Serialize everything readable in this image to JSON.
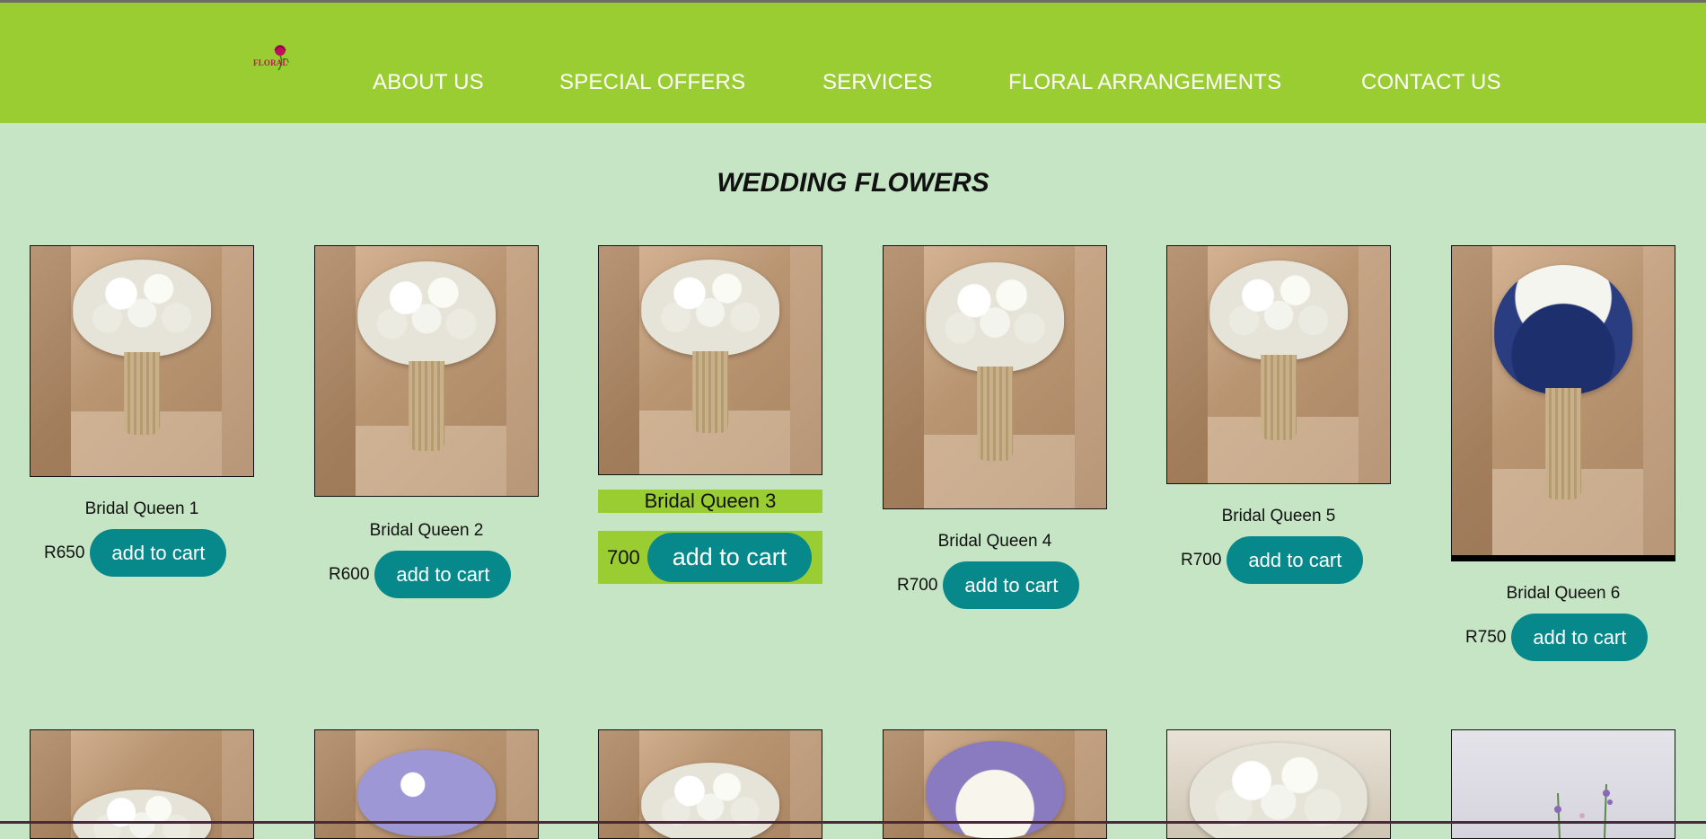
{
  "brand": {
    "logo_text": "FLORAL"
  },
  "nav": [
    {
      "label": "ABOUT US"
    },
    {
      "label": "SPECIAL OFFERS"
    },
    {
      "label": "SERVICES"
    },
    {
      "label": "FLORAL ARRANGEMENTS"
    },
    {
      "label": "CONTACT US"
    }
  ],
  "page": {
    "title": "WEDDING FLOWERS"
  },
  "products": [
    {
      "name": "Bridal Queen 1",
      "price": "R650",
      "button": "add to cart"
    },
    {
      "name": "Bridal Queen 2",
      "price": "R600",
      "button": "add to cart"
    },
    {
      "name": "Bridal Queen 3",
      "price": "700",
      "button": "add to cart"
    },
    {
      "name": "Bridal Queen 4",
      "price": "R700",
      "button": "add to cart"
    },
    {
      "name": "Bridal Queen 5",
      "price": "R700",
      "button": "add to cart"
    },
    {
      "name": "Bridal Queen 6",
      "price": "R750",
      "button": "add to cart"
    }
  ],
  "colors": {
    "header": "#9acd32",
    "background": "#c5e5c4",
    "button": "#07898c",
    "logo": "#c0105a"
  }
}
